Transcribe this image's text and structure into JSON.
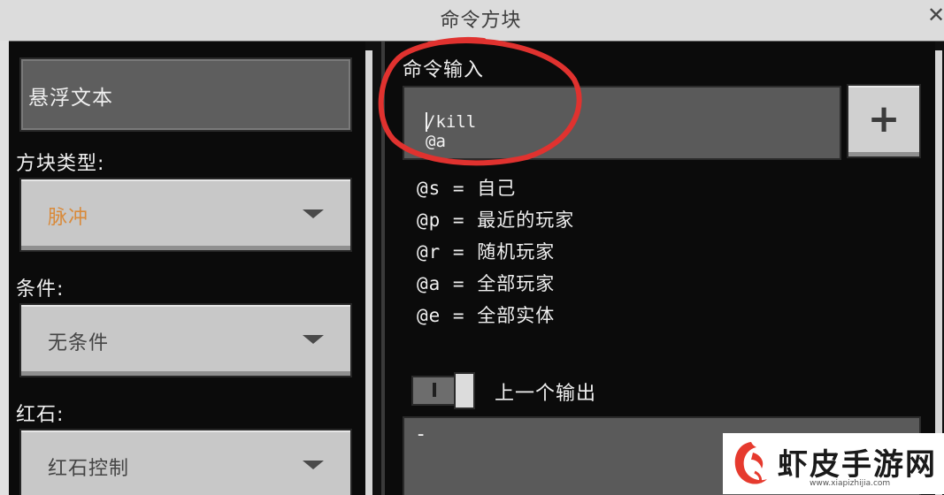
{
  "window": {
    "title": "命令方块",
    "close_glyph": "✕"
  },
  "left": {
    "hover_text": "悬浮文本",
    "block_type": {
      "label": "方块类型:",
      "value": "脉冲",
      "value_color": "#d98a3a"
    },
    "condition": {
      "label": "条件:",
      "value": "无条件"
    },
    "redstone": {
      "label": "红石:",
      "value": "红石控制"
    }
  },
  "right": {
    "command_label": "命令输入",
    "command_value": "/kill @a",
    "plus_glyph": "+",
    "selectors": [
      "@s = 自己",
      "@p = 最近的玩家",
      "@r = 随机玩家",
      "@a = 全部玩家",
      "@e = 全部实体"
    ],
    "previous_output_label": "上一个输出",
    "previous_output_value": "-"
  },
  "annotation": {
    "color": "#e0322f"
  },
  "watermark": {
    "name": "虾皮手游网",
    "url": "www.xiapizhijia.com"
  },
  "icons": [
    "close-icon",
    "dropdown-arrow-icon",
    "plus-icon",
    "toggle-switch",
    "shrimp-logo-icon"
  ]
}
